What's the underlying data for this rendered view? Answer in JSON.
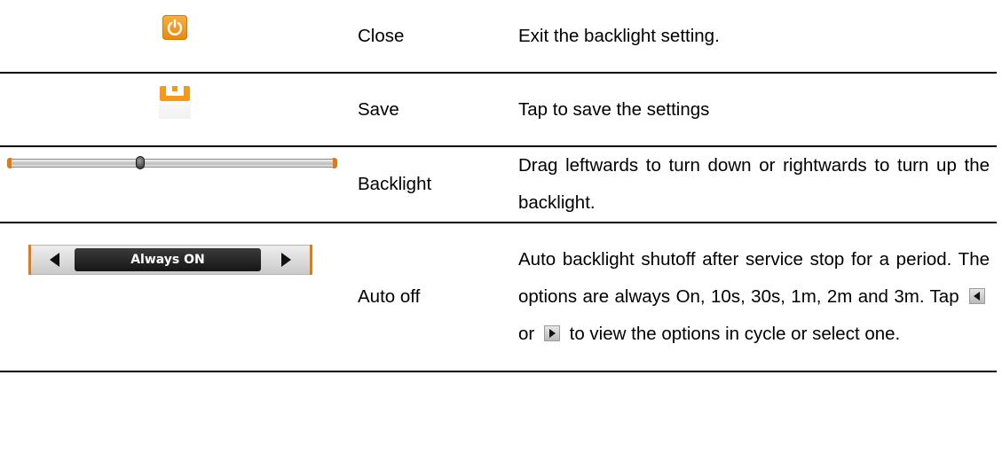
{
  "rows": [
    {
      "icon": "power-icon",
      "name": "Close",
      "description": "Exit the backlight setting."
    },
    {
      "icon": "save-icon",
      "name": "Save",
      "description": "Tap to save the settings"
    },
    {
      "icon": "backlight-slider",
      "name": "Backlight",
      "description": "Drag leftwards to turn down or rightwards to turn up the backlight.",
      "slider_level": 0.4
    },
    {
      "icon": "auto-off-selector",
      "name": "Auto off",
      "selector_value": "Always ON",
      "description_part1": "Auto backlight shutoff after service stop for a period. The options are always On, 10s, 30s, 1m, 2m and 3m. Tap",
      "description_or": "or",
      "description_part2": "to view the options in cycle or select one."
    }
  ],
  "colors": {
    "accent": "#e27a11",
    "text": "#000000",
    "rule": "#000000"
  }
}
